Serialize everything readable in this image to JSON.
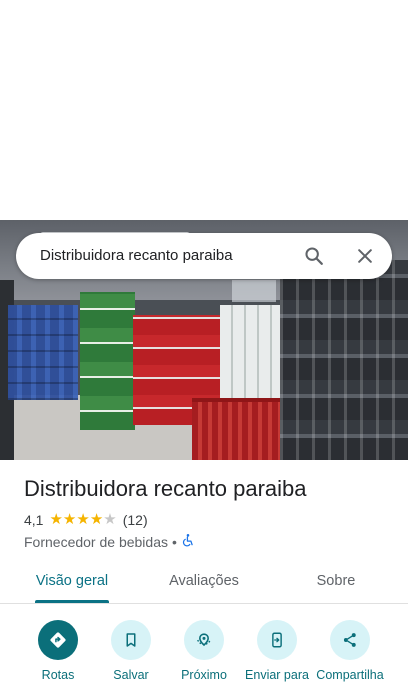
{
  "search": {
    "query": "Distribuidora recanto paraiba"
  },
  "place": {
    "name": "Distribuidora recanto paraiba",
    "rating": "4,1",
    "rating_value": 4.1,
    "reviews_count": "(12)",
    "category": "Fornecedor de bebidas",
    "separator": "•"
  },
  "tabs": [
    {
      "label": "Visão geral"
    },
    {
      "label": "Avaliações"
    },
    {
      "label": "Sobre"
    }
  ],
  "actions": [
    {
      "label": "Rotas",
      "icon": "directions-icon"
    },
    {
      "label": "Salvar",
      "icon": "bookmark-icon"
    },
    {
      "label": "Próximo",
      "icon": "nearby-icon"
    },
    {
      "label": "Enviar para",
      "icon": "send-to-phone-icon"
    },
    {
      "label": "Compartilha",
      "icon": "share-icon"
    }
  ],
  "colors": {
    "accent": "#0b6f7a",
    "accent_light": "#d7f3f7",
    "star": "#f5b400"
  }
}
